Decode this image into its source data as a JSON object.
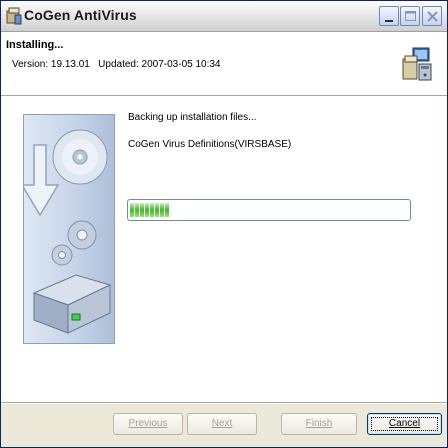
{
  "window": {
    "title": "CoGen AntiVirus"
  },
  "header": {
    "title": "Installing...",
    "version_line": "Version: 19.13.01   Updated: 2007-03-05 10:34"
  },
  "status": {
    "line1": "Backing up installation files...",
    "line2": "CoGen Virus Definitions(VIRSBASE)"
  },
  "progress": {
    "segments_filled": 8,
    "fraction": 0.17
  },
  "buttons": {
    "previous": "Previous",
    "next": "Next",
    "finish": "Finish",
    "cancel": "Cancel"
  },
  "colors": {
    "title_border": "#0a246a",
    "progress_green": "#3fb820"
  },
  "icons": {
    "app": "setup-box-icon",
    "header": "installer-computer-icon",
    "side": "cd-download-gears-drive-illustration"
  }
}
